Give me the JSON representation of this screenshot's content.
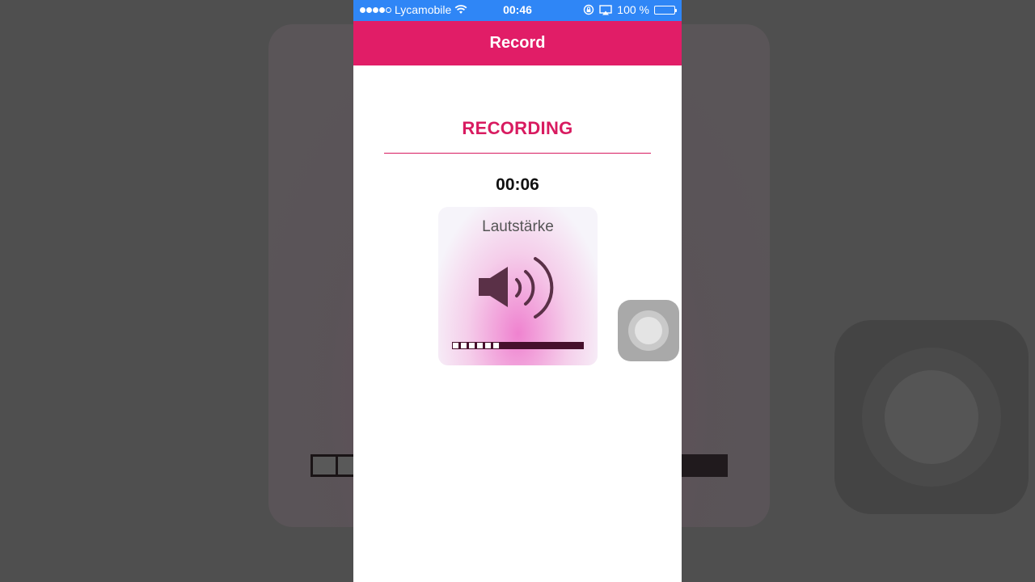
{
  "status_bar": {
    "carrier": "Lycamobile",
    "time": "00:46",
    "battery_percent": "100 %",
    "signal_bars_filled": 4,
    "signal_bars_total": 5
  },
  "nav": {
    "title": "Record"
  },
  "recording": {
    "heading": "RECORDING",
    "timer": "00:06"
  },
  "volume_hud": {
    "title": "Lautstärke",
    "level_fraction": 0.38,
    "segments_total": 16,
    "segments_shown_empty": 6
  },
  "colors": {
    "accent": "#e11d67",
    "status_bar": "#2f86f6"
  },
  "icons": [
    "wifi-icon",
    "orientation-lock-icon",
    "airplay-icon",
    "battery-icon",
    "speaker-icon",
    "assistive-touch-icon"
  ]
}
